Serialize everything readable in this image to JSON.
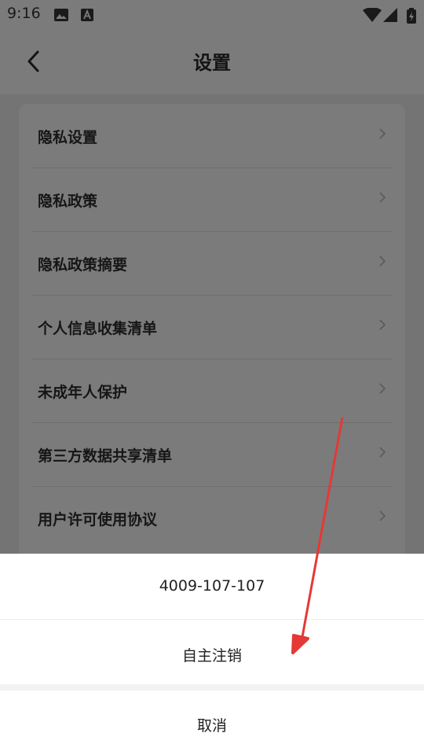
{
  "status_bar": {
    "time": "9:16",
    "icons": [
      "image-icon",
      "font-icon",
      "wifi-icon",
      "signal-icon",
      "battery-charging-icon"
    ]
  },
  "header": {
    "title": "设置",
    "back_icon": "back-chevron-icon"
  },
  "settings": {
    "items": [
      {
        "label": "隐私设置"
      },
      {
        "label": "隐私政策"
      },
      {
        "label": "隐私政策摘要"
      },
      {
        "label": "个人信息收集清单"
      },
      {
        "label": "未成年人保护"
      },
      {
        "label": "第三方数据共享清单"
      },
      {
        "label": "用户许可使用协议"
      }
    ]
  },
  "action_sheet": {
    "phone": "4009-107-107",
    "self_cancel": "自主注销",
    "cancel": "取消"
  },
  "colors": {
    "overlay_background": "#7b7b7b",
    "sheet_background": "#ffffff",
    "annotation_arrow": "#e53935"
  }
}
